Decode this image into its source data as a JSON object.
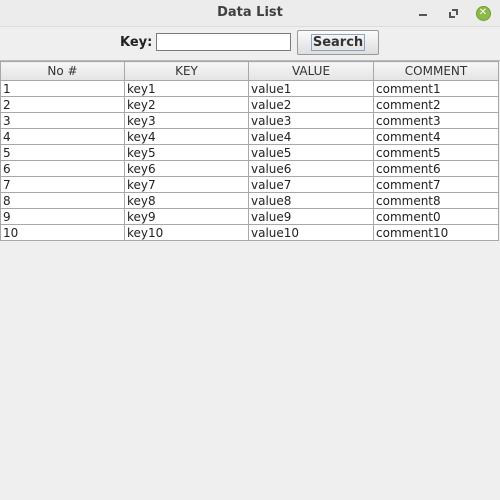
{
  "window": {
    "title": "Data List",
    "controls": [
      "minimize-icon",
      "maximize-icon",
      "close-icon"
    ],
    "close_color": "#8bbb46"
  },
  "search": {
    "label": "Key:",
    "value": "",
    "button_label": "Search"
  },
  "table": {
    "columns": [
      "No #",
      "KEY",
      "VALUE",
      "COMMENT"
    ],
    "rows": [
      [
        "1",
        "key1",
        "value1",
        "comment1"
      ],
      [
        "2",
        "key2",
        "value2",
        "comment2"
      ],
      [
        "3",
        "key3",
        "value3",
        "comment3"
      ],
      [
        "4",
        "key4",
        "value4",
        "comment4"
      ],
      [
        "5",
        "key5",
        "value5",
        "comment5"
      ],
      [
        "6",
        "key6",
        "value6",
        "comment6"
      ],
      [
        "7",
        "key7",
        "value7",
        "comment7"
      ],
      [
        "8",
        "key8",
        "value8",
        "comment8"
      ],
      [
        "9",
        "key9",
        "value9",
        "comment0"
      ],
      [
        "10",
        "key10",
        "value10",
        "comment10"
      ]
    ]
  }
}
